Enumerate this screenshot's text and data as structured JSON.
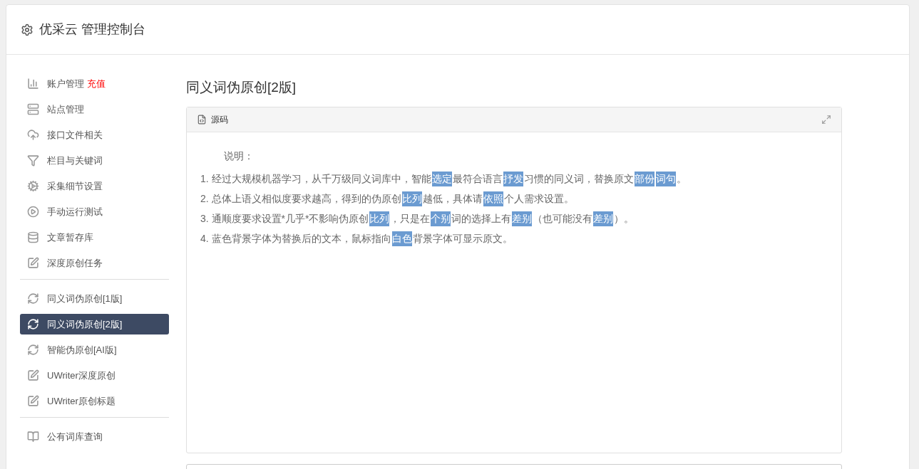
{
  "header": {
    "title": "优采云 管理控制台"
  },
  "sidebar": {
    "groups": [
      [
        {
          "label": "账户管理",
          "badge": "充值",
          "selected": false
        },
        {
          "label": "站点管理",
          "selected": false
        },
        {
          "label": "接口文件相关",
          "selected": false
        },
        {
          "label": "栏目与关键词",
          "selected": false
        },
        {
          "label": "采集细节设置",
          "selected": false
        },
        {
          "label": "手动运行测试",
          "selected": false
        },
        {
          "label": "文章暂存库",
          "selected": false
        },
        {
          "label": "深度原创任务",
          "selected": false
        }
      ],
      [
        {
          "label": "同义词伪原创[1版]",
          "selected": false
        },
        {
          "label": "同义词伪原创[2版]",
          "selected": true
        },
        {
          "label": "智能伪原创[AI版]",
          "selected": false
        },
        {
          "label": "UWriter深度原创",
          "selected": false
        },
        {
          "label": "UWriter原创标题",
          "selected": false
        }
      ],
      [
        {
          "label": "公有词库查询",
          "selected": false
        }
      ]
    ]
  },
  "content": {
    "title": "同义词伪原创[2版]",
    "panel": {
      "title": "源码",
      "intro": "说明：",
      "lines": [
        [
          {
            "text": "1. 经过大规模机器学习，从千万级同义词库中，智能",
            "replaced": false
          },
          {
            "text": "选定",
            "replaced": true
          },
          {
            "text": "最符合语言",
            "replaced": false
          },
          {
            "text": "抒发",
            "replaced": true
          },
          {
            "text": "习惯的同义词，替换原文",
            "replaced": false
          },
          {
            "text": "部份",
            "replaced": true
          },
          {
            "text": "词句",
            "replaced": true
          },
          {
            "text": "。",
            "replaced": false
          }
        ],
        [
          {
            "text": "2. 总体上语义相似度要求越高，得到的伪原创",
            "replaced": false
          },
          {
            "text": "比列",
            "replaced": true
          },
          {
            "text": "越低，具体请",
            "replaced": false
          },
          {
            "text": "依照",
            "replaced": true
          },
          {
            "text": "个人需求设置。",
            "replaced": false
          }
        ],
        [
          {
            "text": "3. 通顺度要求设置*几乎*不影响伪原创",
            "replaced": false
          },
          {
            "text": "比列",
            "replaced": true
          },
          {
            "text": "，只是在",
            "replaced": false
          },
          {
            "text": "个别",
            "replaced": true
          },
          {
            "text": "词的选择上有",
            "replaced": false
          },
          {
            "text": "差别",
            "replaced": true
          },
          {
            "text": "（也可能没有",
            "replaced": false
          },
          {
            "text": "差别",
            "replaced": true
          },
          {
            "text": "）。",
            "replaced": false
          }
        ],
        [
          {
            "text": "4. 蓝色背景字体为替换后的文本，鼠标指向",
            "replaced": false
          },
          {
            "text": "白色",
            "replaced": true
          },
          {
            "text": "背景字体可显示原文。",
            "replaced": false
          }
        ]
      ]
    }
  }
}
